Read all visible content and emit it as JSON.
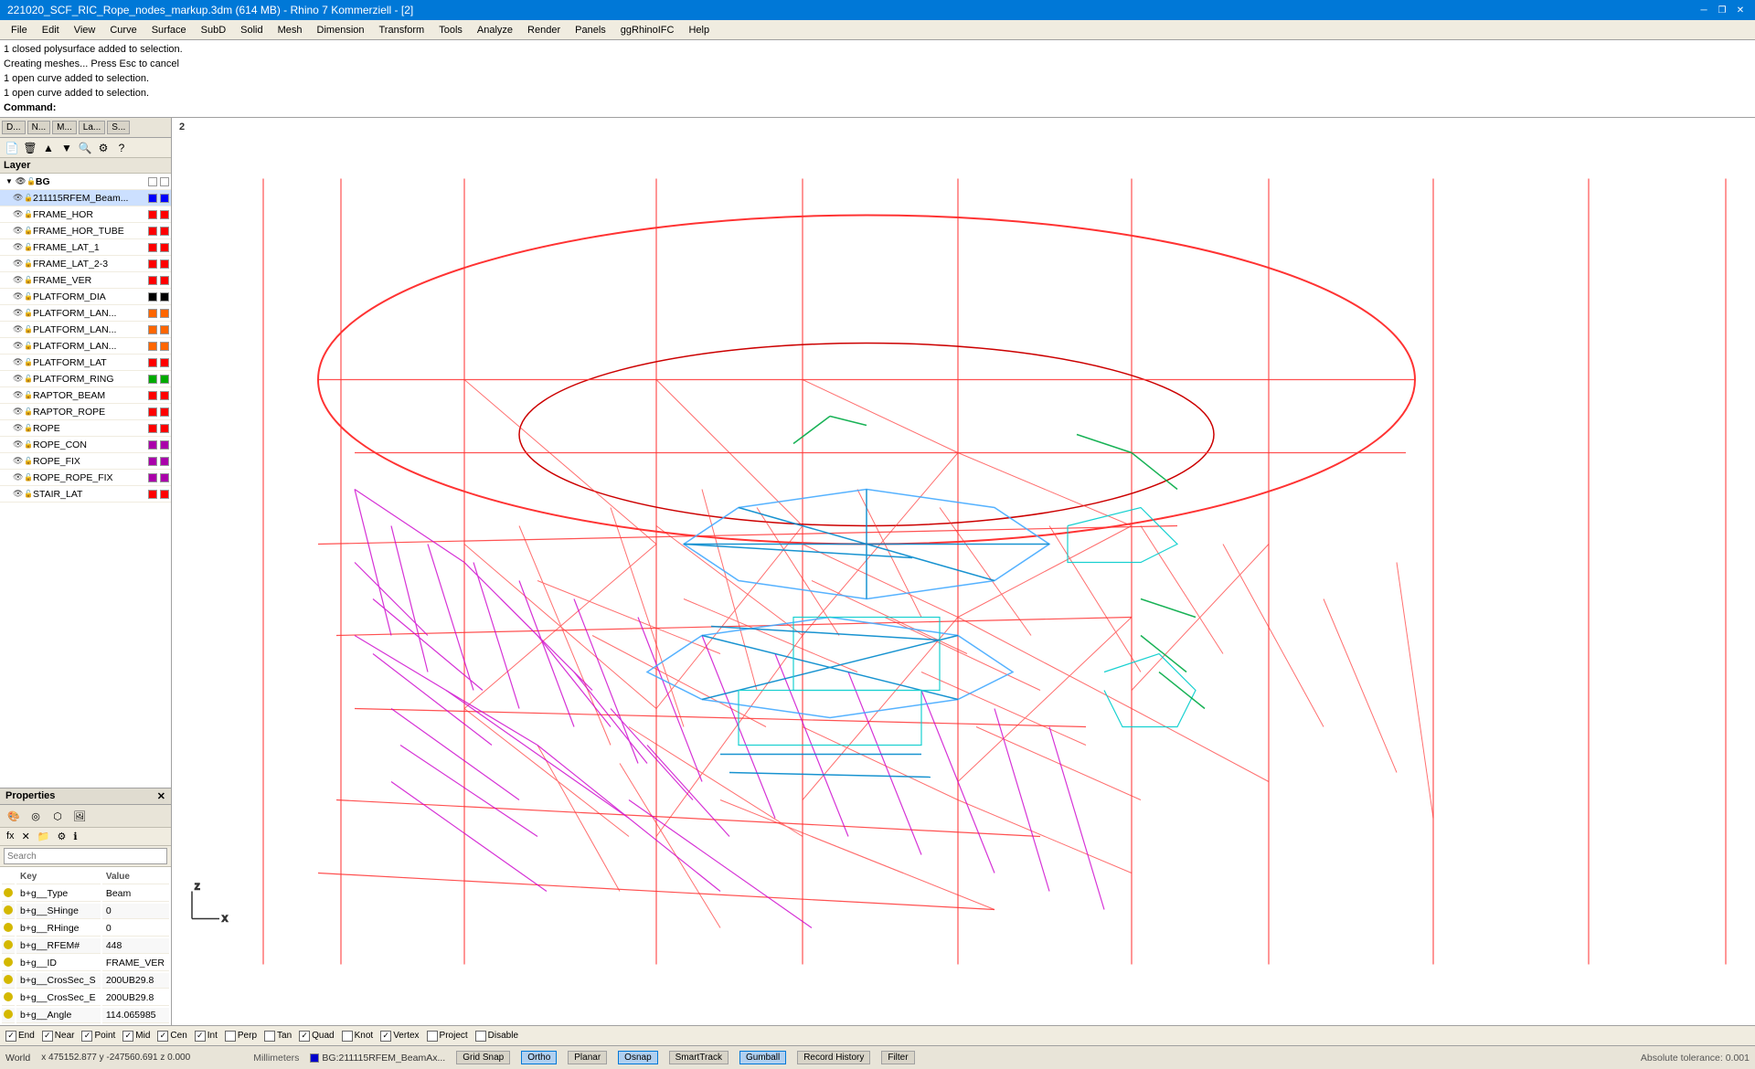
{
  "titlebar": {
    "title": "221020_SCF_RIC_Rope_nodes_markup.3dm (614 MB) - Rhino 7 Kommerziell - [2]",
    "minimize": "─",
    "maximize": "□",
    "close": "✕",
    "restore": "❐"
  },
  "menubar": {
    "items": [
      "File",
      "Edit",
      "View",
      "Curve",
      "Surface",
      "SubD",
      "Solid",
      "Mesh",
      "Dimension",
      "Transform",
      "Tools",
      "Analyze",
      "Render",
      "Panels",
      "ggRhinoIFC",
      "Help"
    ]
  },
  "command_output": {
    "line1": "1 closed polysurface added to selection.",
    "line2": "Creating meshes... Press Esc to cancel",
    "line3": "1 open curve added to selection.",
    "line4": "1 open curve added to selection.",
    "prompt": "Command:"
  },
  "panel_tabs": {
    "items": [
      "D...",
      "N...",
      "M...",
      "La...",
      "S..."
    ]
  },
  "layers": {
    "header": "Layer",
    "items": [
      {
        "name": "BG",
        "indent": 0,
        "color": "#ffffff",
        "selected": false,
        "parent": true,
        "visible": true,
        "lock": false
      },
      {
        "name": "211115RFEM_Beam...",
        "indent": 1,
        "color": "#0000ff",
        "selected": true,
        "parent": false,
        "visible": true,
        "lock": false
      },
      {
        "name": "FRAME_HOR",
        "indent": 1,
        "color": "#ff0000",
        "selected": false,
        "parent": false,
        "visible": true,
        "lock": false
      },
      {
        "name": "FRAME_HOR_TUBE",
        "indent": 1,
        "color": "#ff0000",
        "selected": false,
        "parent": false,
        "visible": true,
        "lock": false
      },
      {
        "name": "FRAME_LAT_1",
        "indent": 1,
        "color": "#ff0000",
        "selected": false,
        "parent": false,
        "visible": true,
        "lock": false
      },
      {
        "name": "FRAME_LAT_2-3",
        "indent": 1,
        "color": "#ff0000",
        "selected": false,
        "parent": false,
        "visible": true,
        "lock": false
      },
      {
        "name": "FRAME_VER",
        "indent": 1,
        "color": "#ff0000",
        "selected": false,
        "parent": false,
        "visible": true,
        "lock": false
      },
      {
        "name": "PLATFORM_DIA",
        "indent": 1,
        "color": "#000000",
        "selected": false,
        "parent": false,
        "visible": true,
        "lock": false
      },
      {
        "name": "PLATFORM_LAN...",
        "indent": 1,
        "color": "#ff6600",
        "selected": false,
        "parent": false,
        "visible": true,
        "lock": false
      },
      {
        "name": "PLATFORM_LAN...",
        "indent": 1,
        "color": "#ff6600",
        "selected": false,
        "parent": false,
        "visible": true,
        "lock": false
      },
      {
        "name": "PLATFORM_LAN...",
        "indent": 1,
        "color": "#ff6600",
        "selected": false,
        "parent": false,
        "visible": true,
        "lock": false
      },
      {
        "name": "PLATFORM_LAT",
        "indent": 1,
        "color": "#ff0000",
        "selected": false,
        "parent": false,
        "visible": true,
        "lock": false
      },
      {
        "name": "PLATFORM_RING",
        "indent": 1,
        "color": "#00aa00",
        "selected": false,
        "parent": false,
        "visible": true,
        "lock": false
      },
      {
        "name": "RAPTOR_BEAM",
        "indent": 1,
        "color": "#ff0000",
        "selected": false,
        "parent": false,
        "visible": true,
        "lock": false
      },
      {
        "name": "RAPTOR_ROPE",
        "indent": 1,
        "color": "#ff0000",
        "selected": false,
        "parent": false,
        "visible": true,
        "lock": false
      },
      {
        "name": "ROPE",
        "indent": 1,
        "color": "#ff0000",
        "selected": false,
        "parent": false,
        "visible": true,
        "lock": false
      },
      {
        "name": "ROPE_CON",
        "indent": 1,
        "color": "#aa00aa",
        "selected": false,
        "parent": false,
        "visible": true,
        "lock": false
      },
      {
        "name": "ROPE_FIX",
        "indent": 1,
        "color": "#aa00aa",
        "selected": false,
        "parent": false,
        "visible": true,
        "lock": false
      },
      {
        "name": "ROPE_ROPE_FIX",
        "indent": 1,
        "color": "#aa00aa",
        "selected": false,
        "parent": false,
        "visible": true,
        "lock": false
      },
      {
        "name": "STAIR_LAT",
        "indent": 1,
        "color": "#ff0000",
        "selected": false,
        "parent": false,
        "visible": true,
        "lock": false
      }
    ]
  },
  "properties": {
    "header": "Properties",
    "search_placeholder": "Search",
    "table_headers": [
      "Key",
      "Value"
    ],
    "rows": [
      {
        "key": "b+g__Type",
        "value": "Beam"
      },
      {
        "key": "b+g__SHinge",
        "value": "0"
      },
      {
        "key": "b+g__RHinge",
        "value": "0"
      },
      {
        "key": "b+g__RFEM#",
        "value": "448"
      },
      {
        "key": "b+g__ID",
        "value": "FRAME_VER"
      },
      {
        "key": "b+g__CrosSec_S",
        "value": "200UB29.8"
      },
      {
        "key": "b+g__CrosSec_E",
        "value": "200UB29.8"
      },
      {
        "key": "b+g__Angle",
        "value": "114.065985"
      }
    ]
  },
  "viewport": {
    "label": "2",
    "background": "#ffffff"
  },
  "osnap": {
    "items": [
      {
        "label": "End",
        "checked": true
      },
      {
        "label": "Near",
        "checked": true
      },
      {
        "label": "Point",
        "checked": true
      },
      {
        "label": "Mid",
        "checked": true
      },
      {
        "label": "Cen",
        "checked": true
      },
      {
        "label": "Int",
        "checked": true
      },
      {
        "label": "Perp",
        "checked": false
      },
      {
        "label": "Tan",
        "checked": false
      },
      {
        "label": "Quad",
        "checked": true
      },
      {
        "label": "Knot",
        "checked": false
      },
      {
        "label": "Vertex",
        "checked": true
      },
      {
        "label": "Project",
        "checked": false
      },
      {
        "label": "Disable",
        "checked": false
      }
    ]
  },
  "statusbar": {
    "world": "World",
    "coords": "x 475152.877  y -247560.691  z 0.000",
    "units": "Millimeters",
    "layer_name": "BG:211115RFEM_BeamAx...",
    "layer_color": "#0000cc",
    "grid_snap": "Grid Snap",
    "ortho": "Ortho",
    "planar": "Planar",
    "osnap": "Osnap",
    "smarttrack": "SmartTrack",
    "gumball": "Gumball",
    "record_history": "Record History",
    "filter": "Filter",
    "tolerance": "Absolute tolerance: 0.001"
  }
}
